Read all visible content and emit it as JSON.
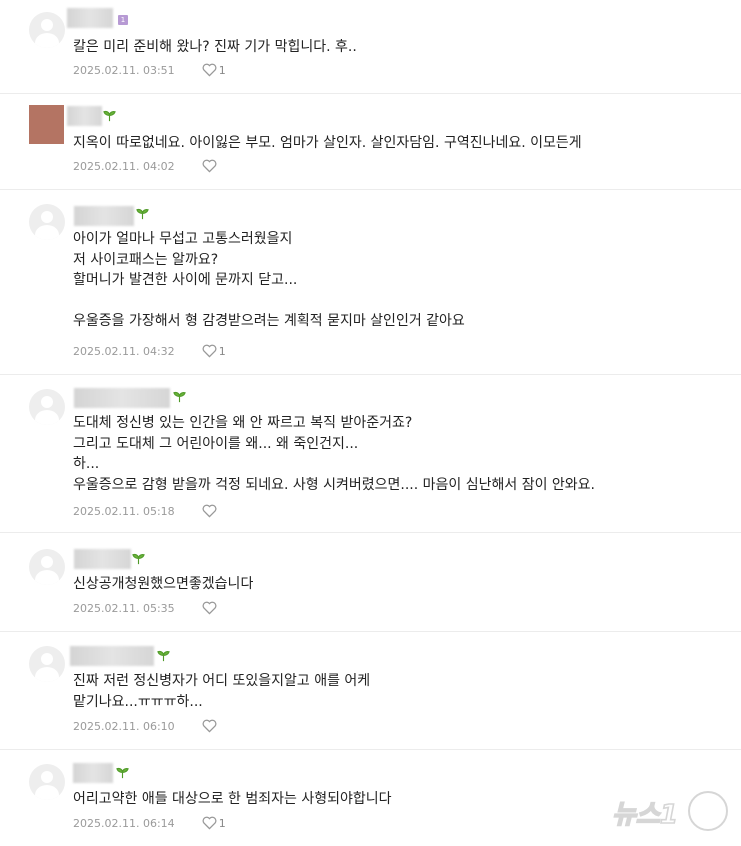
{
  "comments": [
    {
      "badge": "1",
      "text": "칼은 미리 준비해 왔나? 진짜 기가 막힙니다. 후..",
      "date": "2025.02.11. 03:51",
      "likes": "1"
    },
    {
      "text": "지옥이 따로없네요. 아이잃은 부모. 엄마가 살인자. 살인자담임. 구역진나네요. 이모든게",
      "date": "2025.02.11. 04:02",
      "likes": ""
    },
    {
      "text": "아이가 얼마나 무섭고 고통스러웠을지\n저 사이코패스는 알까요?\n할머니가 발견한 사이에 문까지 닫고...\n\n우울증을 가장해서 형 감경받으려는 계획적 묻지마 살인인거 같아요",
      "date": "2025.02.11. 04:32",
      "likes": "1"
    },
    {
      "text": "도대체 정신병 있는 인간을 왜 안 짜르고 복직 받아준거죠?\n그리고 도대체 그 어린아이를 왜... 왜 죽인건지...\n하...\n우울증으로 감형 받을까 걱정 되네요. 사형 시켜버렸으면.... 마음이 심난해서 잠이 안와요.",
      "date": "2025.02.11. 05:18",
      "likes": ""
    },
    {
      "text": "신상공개청원했으면좋겠습니다",
      "date": "2025.02.11. 05:35",
      "likes": ""
    },
    {
      "text": "진짜 저런 정신병자가 어디 또있을지알고 애를 어케\n맡기나요...ㅠㅠㅠ하...",
      "date": "2025.02.11. 06:10",
      "likes": ""
    },
    {
      "text": "어리고약한 애들 대상으로 한 범죄자는 사형되야합니다",
      "date": "2025.02.11. 06:14",
      "likes": "1"
    }
  ],
  "watermark": "뉴스1"
}
